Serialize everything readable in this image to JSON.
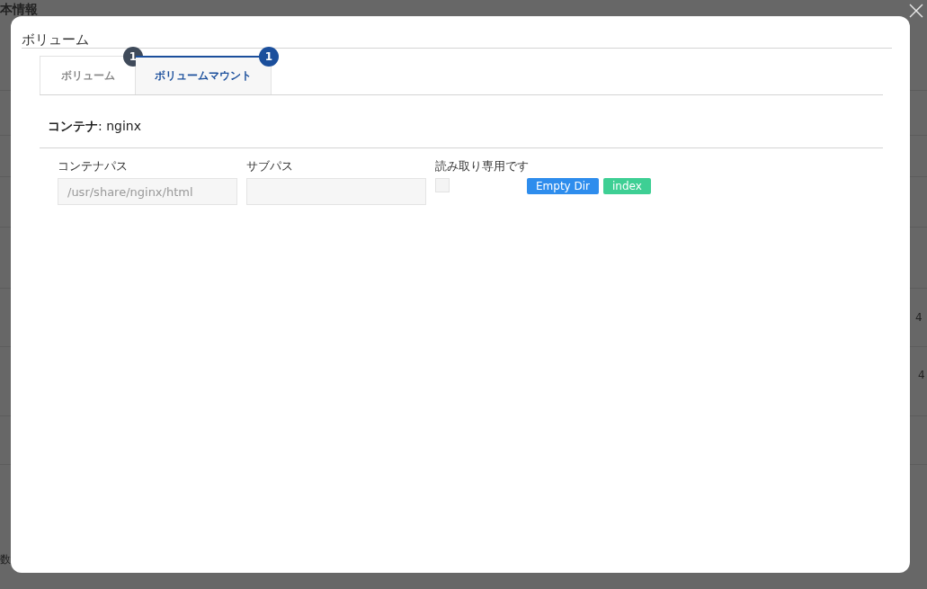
{
  "background": {
    "texts": [
      "本情報",
      "数",
      "4",
      "4"
    ]
  },
  "dialog": {
    "title": "ボリューム",
    "tabs": [
      {
        "label": "ボリューム",
        "count": "1",
        "selected": false
      },
      {
        "label": "ボリュームマウント",
        "count": "1",
        "selected": true
      }
    ],
    "container_heading": "**コンテナ**: nginx",
    "mounts": [
      {
        "container_path_label": "コンテナパス",
        "container_path": "/usr/share/nginx/html",
        "sub_path_label": "サブパス",
        "read_only_label": "読み取り専用です",
        "read_only": false,
        "tags": [
          {
            "label": "Empty Dir",
            "color": "#2e8ded"
          },
          {
            "label": "index",
            "color": "#3ecf94"
          }
        ]
      }
    ]
  }
}
